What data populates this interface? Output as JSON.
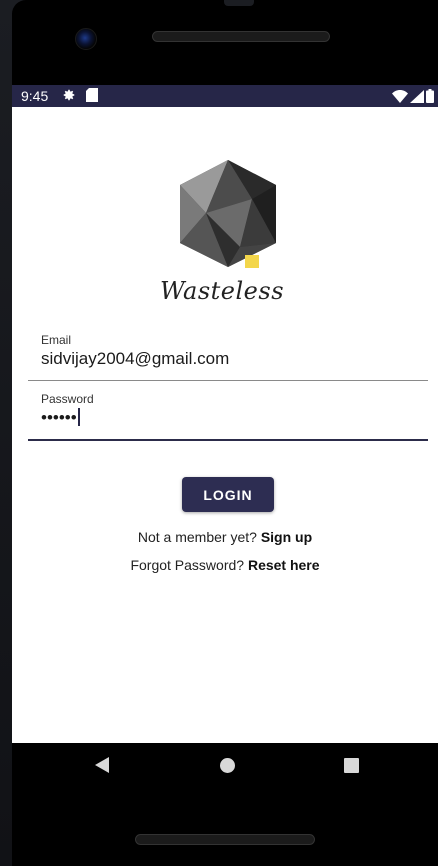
{
  "status_bar": {
    "time": "9:45",
    "left_icons": [
      "settings-gear-icon",
      "sd-card-icon"
    ],
    "right_icons": [
      "wifi-icon",
      "signal-icon",
      "battery-icon"
    ],
    "background": "#262648"
  },
  "brand": {
    "name": "Wasteless",
    "logo": "geometric-polyhedron-logo"
  },
  "form": {
    "email_label": "Email",
    "email_value": "sidvijay2004@gmail.com",
    "password_label": "Password",
    "password_value": "••••••",
    "login_label": "LOGIN",
    "accent": "#2d2d52"
  },
  "links": {
    "signup_prefix": "Not a member yet?",
    "signup_link": "Sign up",
    "reset_prefix": "Forgot Password?",
    "reset_link": "Reset here"
  },
  "nav": {
    "buttons": [
      "back-icon",
      "home-icon",
      "recents-icon"
    ]
  }
}
